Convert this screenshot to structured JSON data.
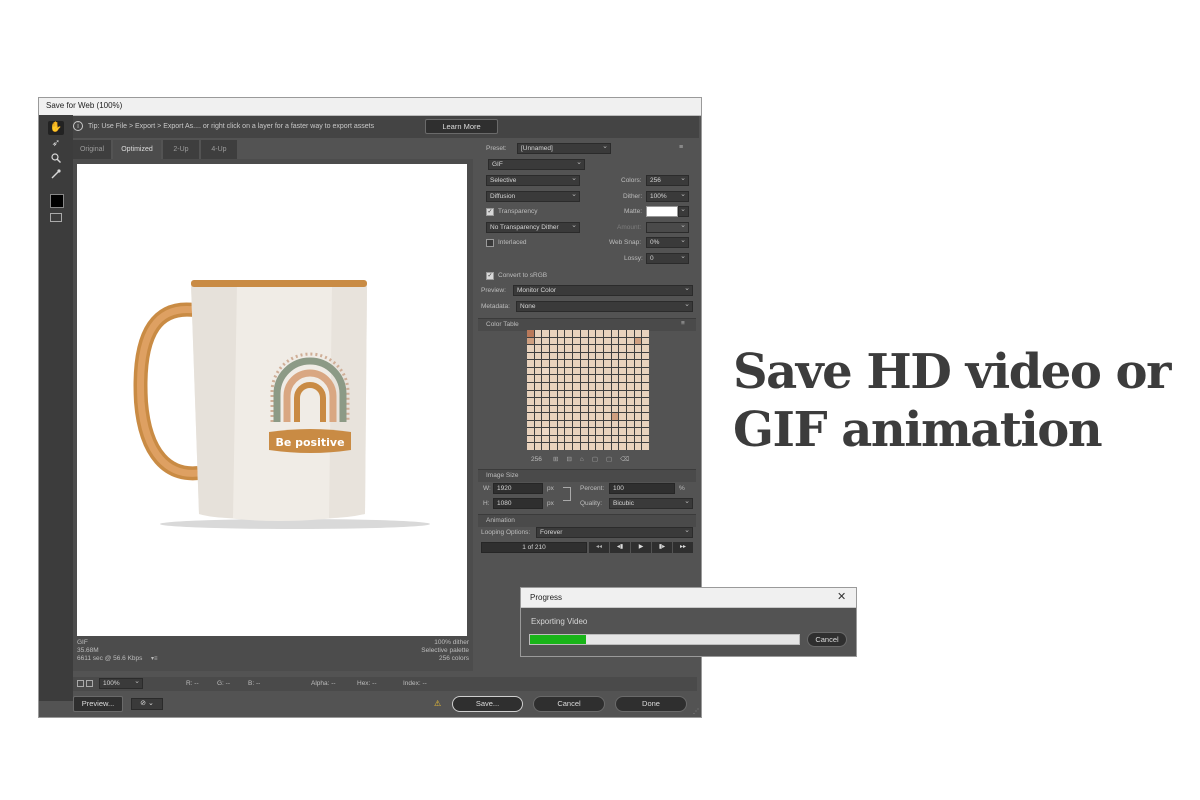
{
  "window": {
    "title": "Save for Web (100%)",
    "tip": "Tip: Use File > Export > Export As.... or right click on a layer for a faster way to export assets",
    "learn_more": "Learn More",
    "tabs": [
      "Original",
      "Optimized",
      "2-Up",
      "4-Up"
    ],
    "active_tab": "Optimized"
  },
  "tools": [
    "hand-tool-icon",
    "slice-select-tool-icon",
    "zoom-tool-icon",
    "eyedropper-tool-icon",
    "eyedropper-color-swatch",
    "toggle-slices-icon"
  ],
  "canvas": {
    "mug_text": "Be positive",
    "info_left": [
      "GIF",
      "35.68M",
      "6611 sec @ 56.6 Kbps"
    ],
    "info_right": [
      "100% dither",
      "Selective palette",
      "256 colors"
    ]
  },
  "settings": {
    "preset_label": "Preset:",
    "preset_value": "[Unnamed]",
    "format": "GIF",
    "reduction": "Selective",
    "dither_algo": "Diffusion",
    "transparency_label": "Transparency",
    "transparency_checked": true,
    "transparency_dither": "No Transparency Dither",
    "interlaced_label": "Interlaced",
    "interlaced_checked": false,
    "colors_label": "Colors:",
    "colors_value": "256",
    "dither_label": "Dither:",
    "dither_value": "100%",
    "matte_label": "Matte:",
    "amount_label": "Amount:",
    "web_snap_label": "Web Snap:",
    "web_snap_value": "0%",
    "lossy_label": "Lossy:",
    "lossy_value": "0",
    "convert_srgb_label": "Convert to sRGB",
    "convert_srgb_checked": true,
    "preview_label": "Preview:",
    "preview_value": "Monitor Color",
    "metadata_label": "Metadata:",
    "metadata_value": "None"
  },
  "color_table": {
    "title": "Color Table",
    "count": "256",
    "palette": [
      "#e8d2bd",
      "#d9a98a",
      "#c98a6a",
      "#f2e4d6",
      "#b9795a",
      "#e0bfa3",
      "#a86a4e",
      "#f6ece2",
      "#cf9f80",
      "#eed9c6",
      "#9c5c44",
      "#dcb597",
      "#c4826a",
      "#f0dccb",
      "#b36f56",
      "#e6c9b2"
    ]
  },
  "image_size": {
    "title": "Image Size",
    "w_label": "W:",
    "w_value": "1920",
    "h_label": "H:",
    "h_value": "1080",
    "unit": "px",
    "percent_label": "Percent:",
    "percent_value": "100",
    "percent_unit": "%",
    "quality_label": "Quality:",
    "quality_value": "Bicubic"
  },
  "animation": {
    "title": "Animation",
    "looping_label": "Looping Options:",
    "looping_value": "Forever",
    "frame_counter": "1 of 210"
  },
  "status_bar": {
    "zoom": "100%",
    "r": "R: --",
    "g": "G: --",
    "b": "B: --",
    "alpha": "Alpha: --",
    "hex": "Hex: --",
    "index": "Index: --"
  },
  "buttons": {
    "preview": "Preview...",
    "save": "Save...",
    "cancel": "Cancel",
    "done": "Done"
  },
  "progress": {
    "title": "Progress",
    "message": "Exporting Video",
    "cancel": "Cancel",
    "value": 0.21
  },
  "headline": {
    "line1": "Save HD video or",
    "line2": "GIF animation"
  }
}
